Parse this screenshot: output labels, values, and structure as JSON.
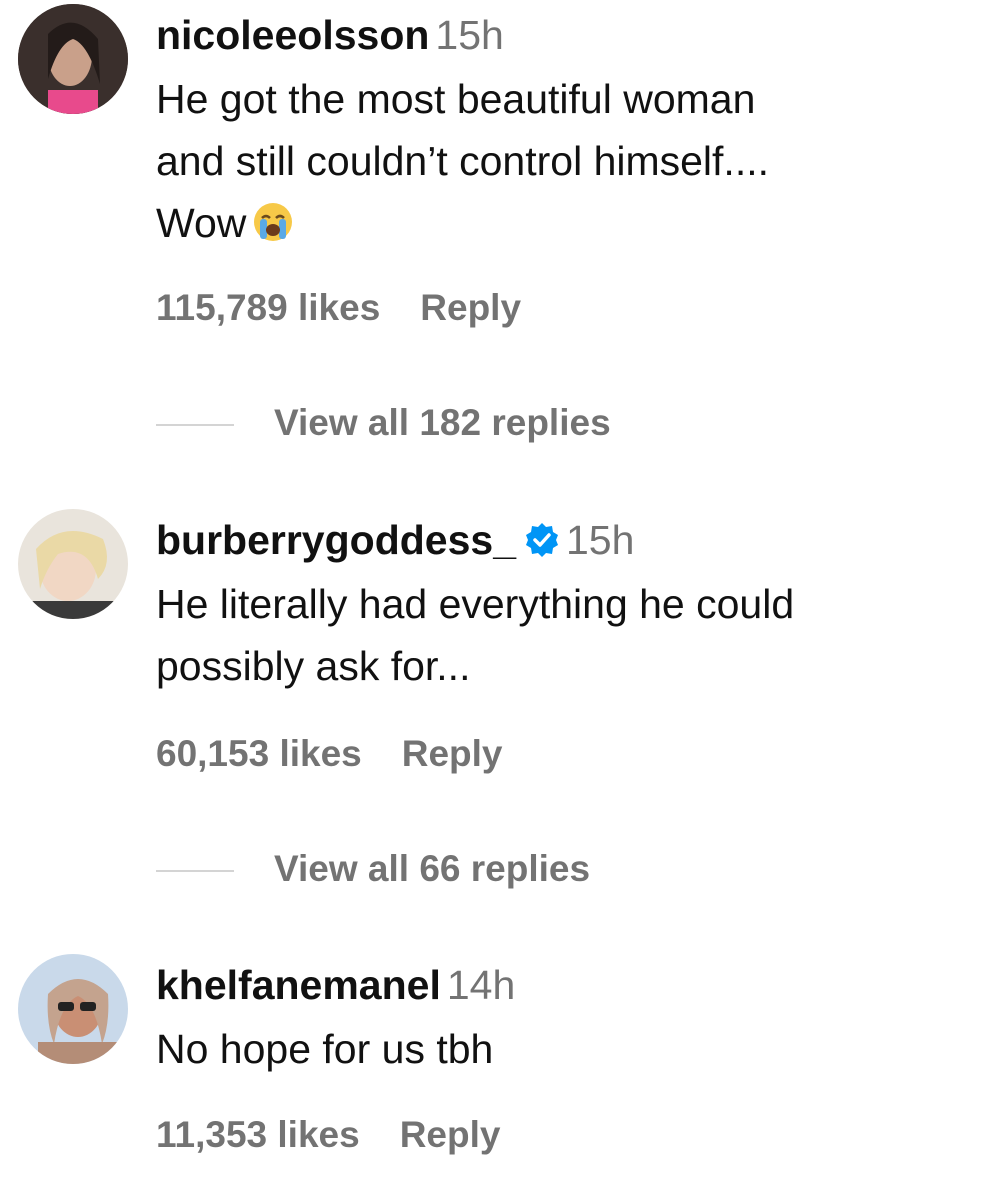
{
  "comments": [
    {
      "username": "nicoleeolsson",
      "verified": false,
      "time": "15h",
      "text_lines": [
        "He got the most beautiful woman",
        "and still couldn’t control himself....",
        "Wow"
      ],
      "emoji": "loudly-crying-face",
      "likes": "115,789 likes",
      "reply_label": "Reply",
      "view_replies": "View all 182 replies"
    },
    {
      "username": "burberrygoddess_",
      "verified": true,
      "time": "15h",
      "text_lines": [
        "He literally had everything he could",
        "possibly ask for..."
      ],
      "likes": "60,153 likes",
      "reply_label": "Reply",
      "view_replies": "View all 66 replies"
    },
    {
      "username": "khelfanemanel",
      "verified": false,
      "time": "14h",
      "text_lines": [
        "No hope for us tbh"
      ],
      "likes": "11,353 likes",
      "reply_label": "Reply"
    }
  ],
  "colors": {
    "text": "#111111",
    "secondary": "#737373",
    "rule": "#d4d4d4",
    "verified": "#0095f6"
  }
}
